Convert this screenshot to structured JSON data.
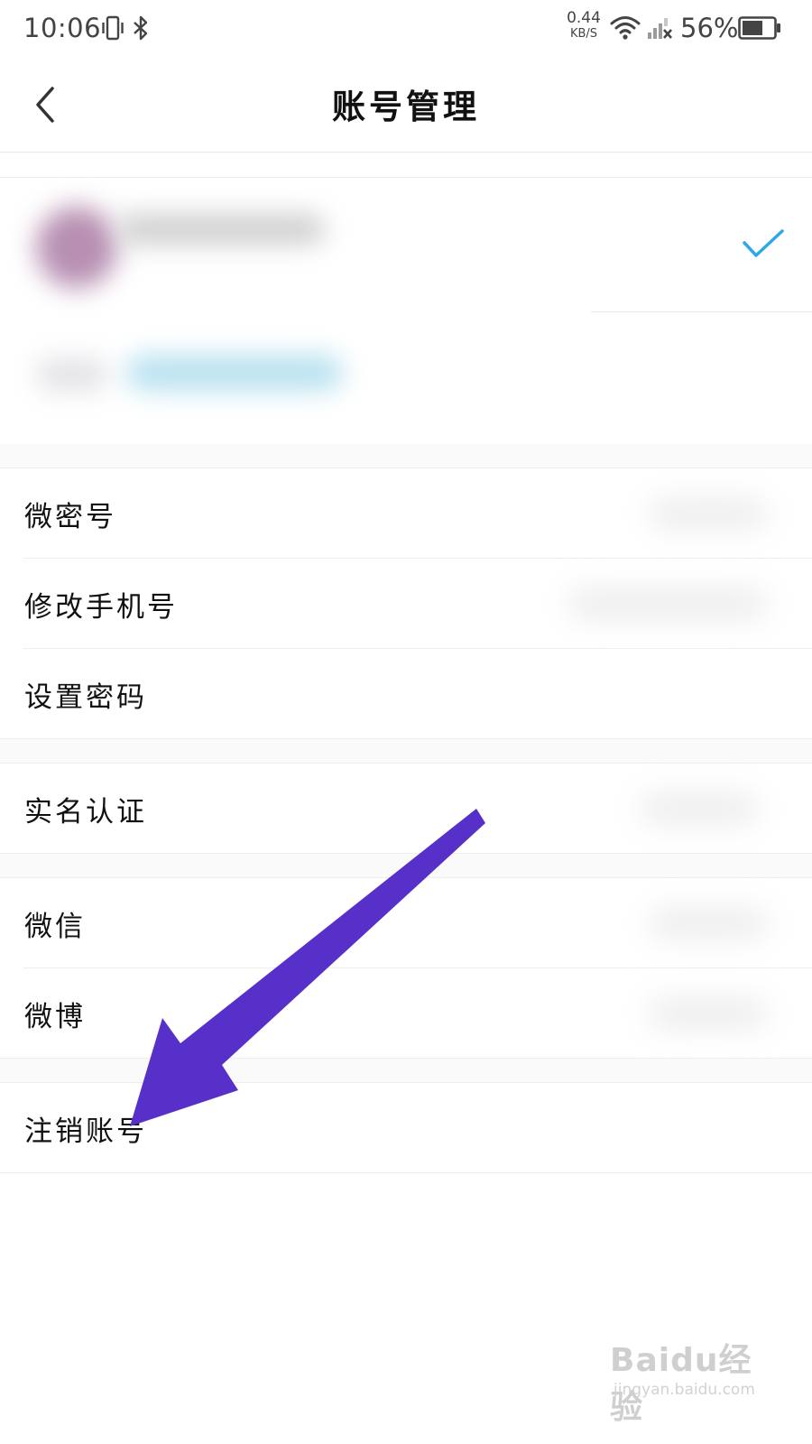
{
  "status_bar": {
    "time": "10:06",
    "net_speed_value": "0.44",
    "net_speed_unit": "KB/S",
    "battery_percent": "56%",
    "icons": [
      "vibrate-icon",
      "bluetooth-icon",
      "wifi-icon",
      "signal-icon",
      "battery-icon"
    ]
  },
  "header": {
    "back_icon": "chevron-left-icon",
    "title": "账号管理"
  },
  "account_card": {
    "selected": true,
    "check_color": "#2ea8e6"
  },
  "menu": {
    "group1": [
      "微密号",
      "修改手机号",
      "设置密码"
    ],
    "group2": [
      "实名认证"
    ],
    "group3": [
      "微信",
      "微博"
    ],
    "group4": [
      "注销账号"
    ]
  },
  "annotation": {
    "arrow_color": "#5630c9"
  },
  "watermark": {
    "logo": "Baidu经验",
    "url": "jingyan.baidu.com"
  }
}
